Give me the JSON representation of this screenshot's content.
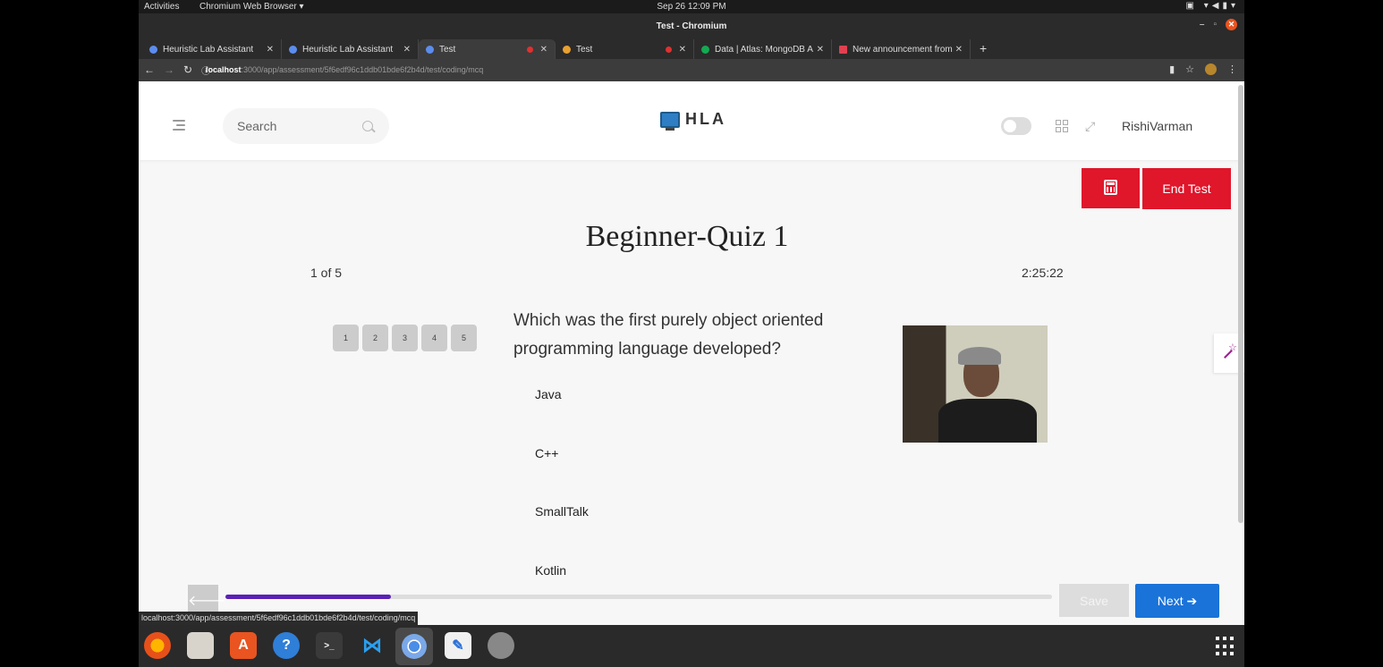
{
  "system": {
    "activities": "Activities",
    "app_menu": "Chromium Web Browser ▾",
    "clock": "Sep 26  12:09 PM",
    "window_title": "Test - Chromium"
  },
  "tabs": [
    {
      "label": "Heuristic Lab Assistant"
    },
    {
      "label": "Heuristic Lab Assistant"
    },
    {
      "label": "Test"
    },
    {
      "label": "Test"
    },
    {
      "label": "Data | Atlas: MongoDB A"
    },
    {
      "label": "New announcement from"
    }
  ],
  "address": {
    "host": "localhost",
    "path": ":3000/app/assessment/5f6edf96c1ddb01bde6f2b4d/test/coding/mcq"
  },
  "header": {
    "search_placeholder": "Search",
    "logo_text": "HLA",
    "username": "RishiVarman"
  },
  "actions": {
    "end_test": "End Test",
    "save": "Save",
    "next": "Next ➔",
    "prev": "🡐"
  },
  "quiz": {
    "title": "Beginner-Quiz 1",
    "progress_text": "1 of 5",
    "timer": "2:25:22",
    "question_numbers": [
      "1",
      "2",
      "3",
      "4",
      "5"
    ],
    "question": "Which was the first purely object oriented programming language developed?",
    "options": [
      "Java",
      "C++",
      "SmallTalk",
      "Kotlin"
    ],
    "progress_fraction": 0.2
  },
  "status_bar_url": "localhost:3000/app/assessment/5f6edf96c1ddb01bde6f2b4d/test/coding/mcq",
  "colors": {
    "accent_red": "#e0162b",
    "accent_blue": "#1a73d9",
    "progress_purple": "#5b21b6"
  },
  "dock": [
    "firefox-icon",
    "files-icon",
    "software-icon",
    "help-icon",
    "terminal-icon",
    "vscode-icon",
    "chromium-icon",
    "text-editor-icon",
    "disk-icon"
  ]
}
